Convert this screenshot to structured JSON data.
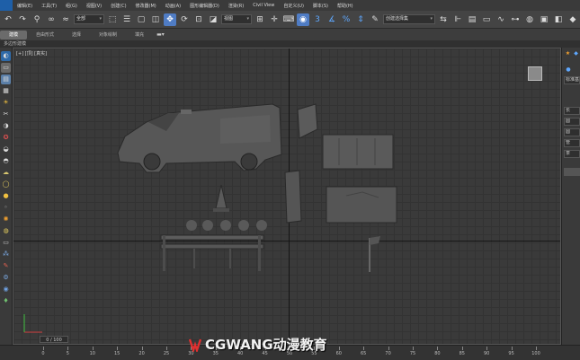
{
  "menubar": {
    "items": [
      "编辑(E)",
      "工具(T)",
      "组(G)",
      "视图(V)",
      "创建(C)",
      "修改器(M)",
      "动画(A)",
      "图形编辑器(D)",
      "渲染(R)",
      "Civil View",
      "自定义(U)",
      "脚本(S)",
      "帮助(H)"
    ]
  },
  "toolbar": {
    "selection_filter": "全部",
    "reference_coord": "视图",
    "named_selection": "创建选择集"
  },
  "ribbon": {
    "tabs": [
      "建模",
      "自由形式",
      "选择",
      "对象绘制",
      "填充"
    ]
  },
  "subribbon": {
    "label": "多边形建模"
  },
  "viewport": {
    "label": "[+] [顶] [真实]"
  },
  "rightpanel": {
    "field": "标准基",
    "labels": [
      "长",
      "圆",
      "圆",
      "管",
      "茶"
    ]
  },
  "statusbar": {
    "frame": "0 / 100",
    "ticks": [
      "0",
      "5",
      "10",
      "15",
      "20",
      "25",
      "30",
      "35",
      "40",
      "45",
      "50",
      "55",
      "60",
      "65",
      "70",
      "75",
      "80",
      "85",
      "90",
      "95",
      "100"
    ]
  },
  "watermark": {
    "text": "CGWANG动漫教育"
  },
  "colors": {
    "accent": "#4f7cc4",
    "viewport_bg": "#3a3a3a",
    "ui_bg": "#444444"
  }
}
